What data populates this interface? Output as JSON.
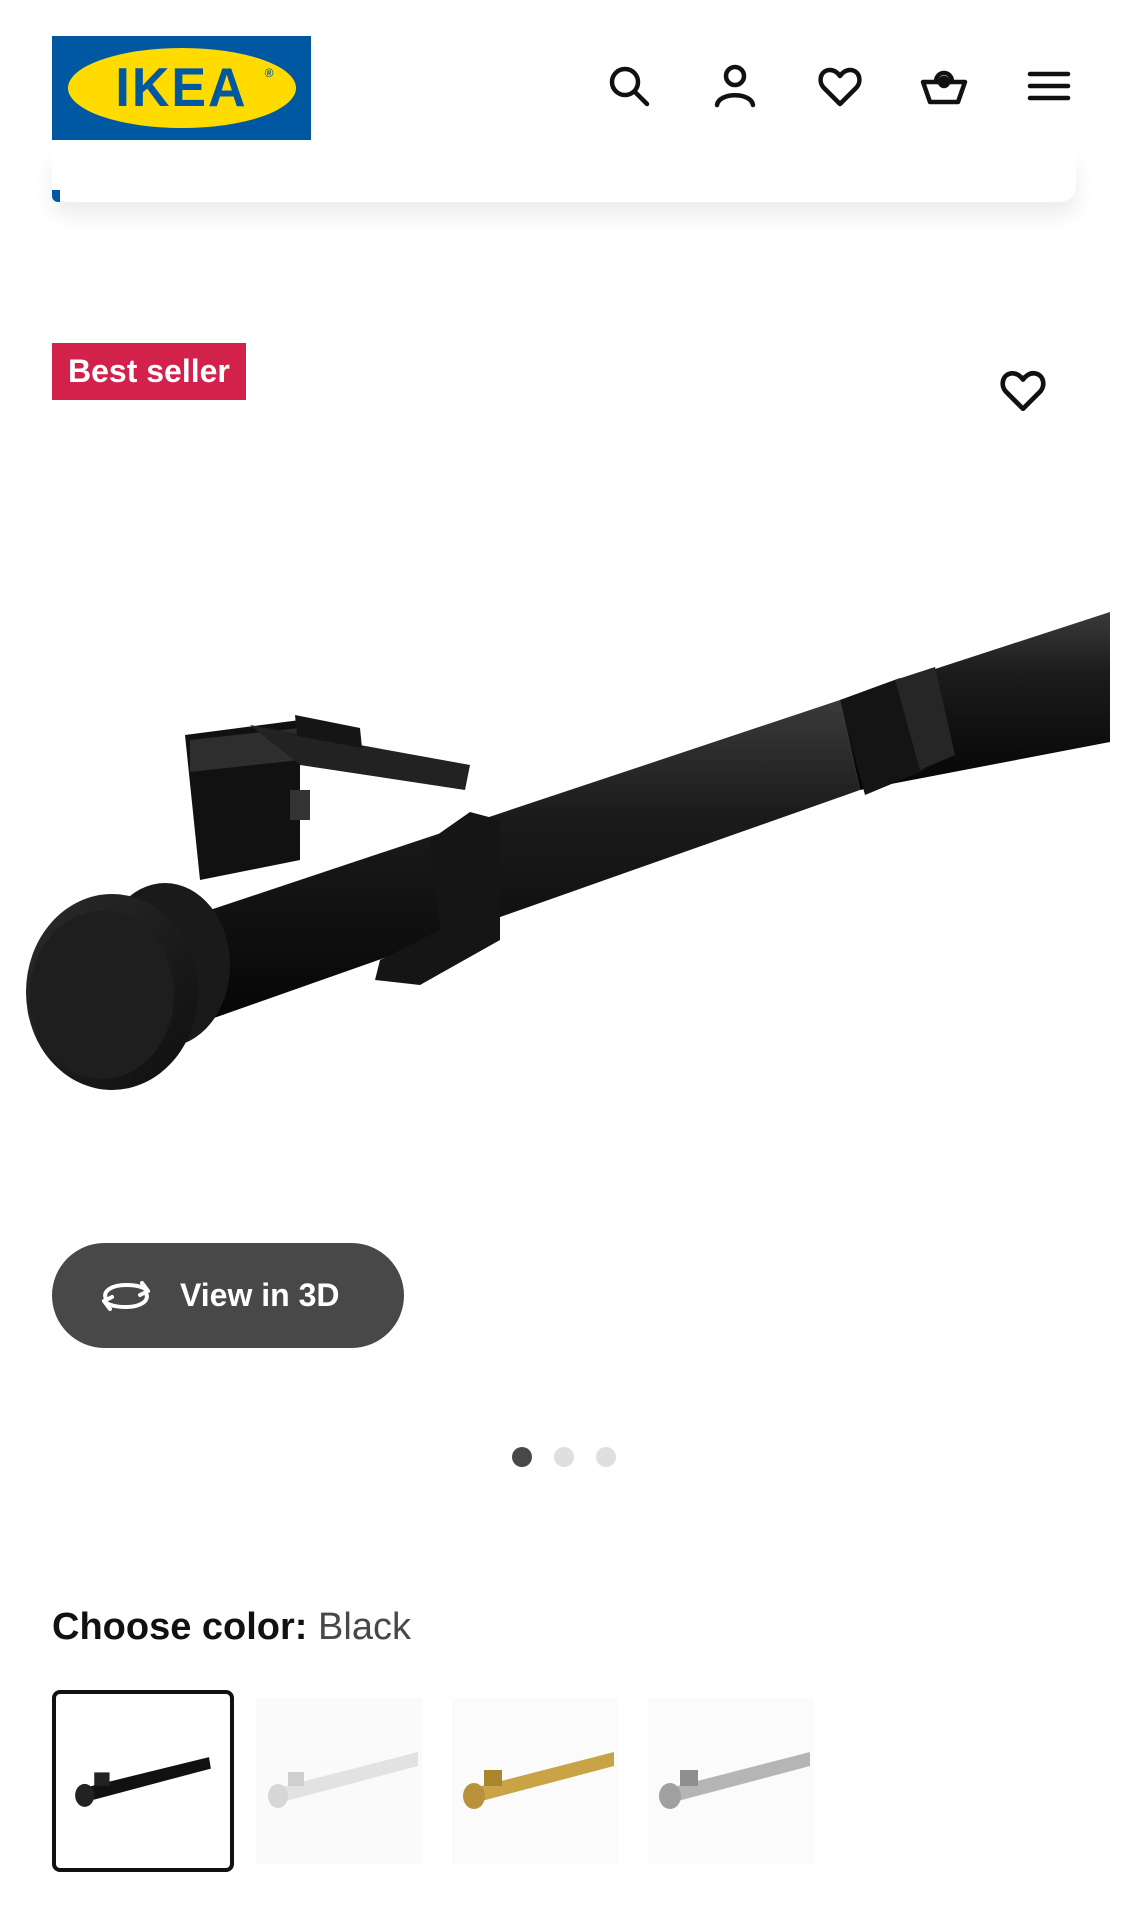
{
  "header": {
    "logo_text": "IKEA",
    "logo_reg": "®",
    "icons": [
      "search-icon",
      "account-icon",
      "favourites-icon",
      "cart-icon",
      "menu-icon"
    ]
  },
  "product": {
    "badge": "Best seller",
    "view_3d_label": "View in 3D",
    "gallery": {
      "current": 1,
      "total": 3
    }
  },
  "color_chooser": {
    "label": "Choose color:",
    "selected": "Black",
    "options": [
      "Black",
      "White",
      "Brass",
      "Silver"
    ]
  },
  "colors": {
    "ikea_blue": "#0058a3",
    "ikea_yellow": "#ffdb00",
    "badge_red": "#d2214b",
    "dark_button": "#484848"
  }
}
